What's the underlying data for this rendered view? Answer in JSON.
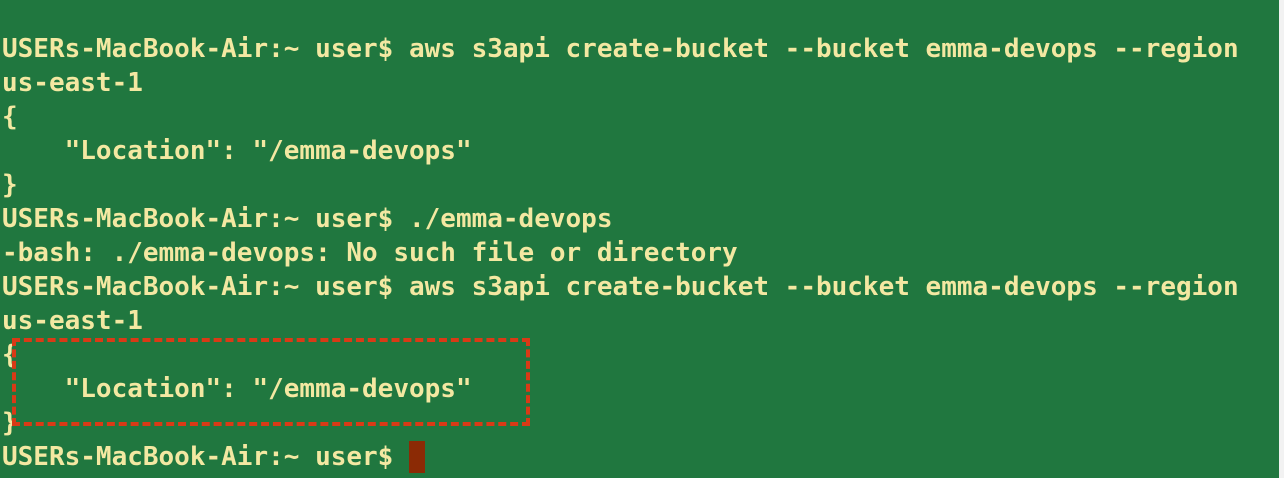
{
  "terminal": {
    "lines": [
      "USERs-MacBook-Air:~ user$ aws s3api create-bucket --bucket emma-devops --region",
      "us-east-1",
      "{",
      "    \"Location\": \"/emma-devops\"",
      "}",
      "USERs-MacBook-Air:~ user$ ./emma-devops",
      "-bash: ./emma-devops: No such file or directory",
      "USERs-MacBook-Air:~ user$ aws s3api create-bucket --bucket emma-devops --region",
      "us-east-1",
      "{",
      "    \"Location\": \"/emma-devops\"",
      "}"
    ],
    "prompt": "USERs-MacBook-Air:~ user$",
    "colors": {
      "background": "#20773f",
      "text": "#f3e8a2",
      "cursor": "#8b2a05",
      "highlight": "#d93a16"
    }
  }
}
